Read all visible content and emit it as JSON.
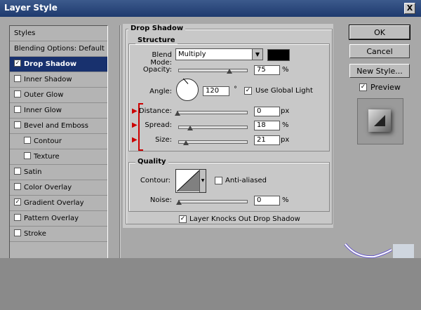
{
  "window": {
    "title": "Layer Style",
    "close_label": "X"
  },
  "styles_list": {
    "header": "Styles",
    "items": [
      {
        "label": "Blending Options: Default",
        "checkbox": false
      },
      {
        "label": "Drop Shadow",
        "checkbox": true,
        "checked": true,
        "selected": true
      },
      {
        "label": "Inner Shadow",
        "checkbox": true,
        "checked": false
      },
      {
        "label": "Outer Glow",
        "checkbox": true,
        "checked": false
      },
      {
        "label": "Inner Glow",
        "checkbox": true,
        "checked": false
      },
      {
        "label": "Bevel and Emboss",
        "checkbox": true,
        "checked": false
      },
      {
        "label": "Contour",
        "checkbox": true,
        "checked": false,
        "sub": true
      },
      {
        "label": "Texture",
        "checkbox": true,
        "checked": false,
        "sub": true
      },
      {
        "label": "Satin",
        "checkbox": true,
        "checked": false
      },
      {
        "label": "Color Overlay",
        "checkbox": true,
        "checked": false
      },
      {
        "label": "Gradient Overlay",
        "checkbox": true,
        "checked": true
      },
      {
        "label": "Pattern Overlay",
        "checkbox": true,
        "checked": false
      },
      {
        "label": "Stroke",
        "checkbox": true,
        "checked": false
      }
    ]
  },
  "drop_shadow": {
    "title": "Drop Shadow",
    "structure": {
      "title": "Structure",
      "blend_mode_label": "Blend Mode:",
      "blend_mode_value": "Multiply",
      "opacity_label": "Opacity:",
      "opacity_value": "75",
      "opacity_unit": "%",
      "angle_label": "Angle:",
      "angle_value": "120",
      "angle_unit": "°",
      "global_light_label": "Use Global Light",
      "global_light_checked": true,
      "distance_label": "Distance:",
      "distance_value": "0",
      "distance_unit": "px",
      "spread_label": "Spread:",
      "spread_value": "18",
      "spread_unit": "%",
      "size_label": "Size:",
      "size_value": "21",
      "size_unit": "px"
    },
    "quality": {
      "title": "Quality",
      "contour_label": "Contour:",
      "anti_aliased_label": "Anti-aliased",
      "anti_aliased_checked": false,
      "noise_label": "Noise:",
      "noise_value": "0",
      "noise_unit": "%"
    },
    "knockout_label": "Layer Knocks Out Drop Shadow",
    "knockout_checked": true
  },
  "buttons": {
    "ok": "OK",
    "cancel": "Cancel",
    "new_style": "New Style...",
    "preview_label": "Preview",
    "preview_checked": true
  },
  "colors": {
    "shadow_color": "#000000",
    "selection": "#18316e",
    "annotation_red": "#cc0000"
  }
}
